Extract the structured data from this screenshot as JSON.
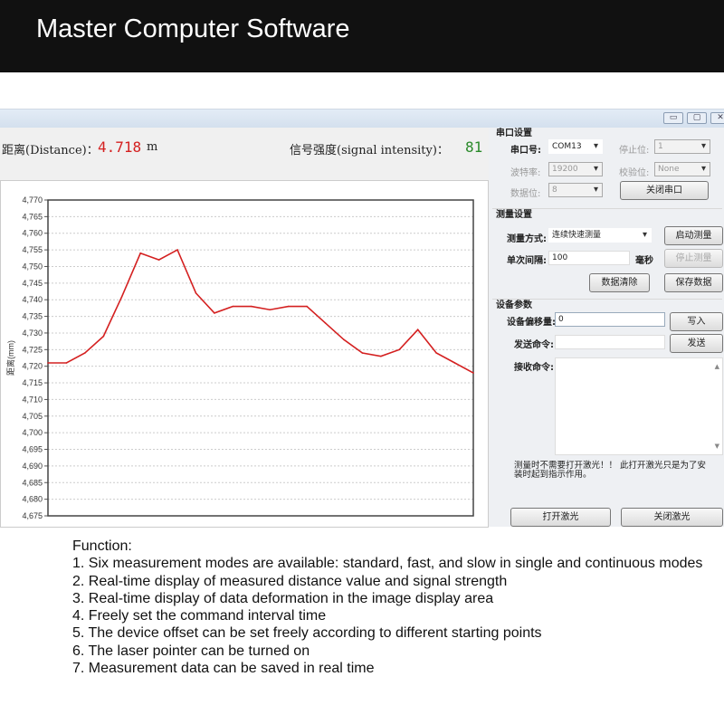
{
  "header": {
    "title": "Master Computer Software"
  },
  "window": {
    "controls": [
      "minimize",
      "maximize",
      "close"
    ]
  },
  "readout": {
    "distance_label": "距离(Distance)：",
    "distance_value": "4.718",
    "distance_unit": "m",
    "signal_label": "信号强度(signal intensity)：",
    "signal_value": "81",
    "distance_color": "#d42020",
    "signal_color": "#2a8a2a"
  },
  "chart_data": {
    "type": "line",
    "ylabel": "距离(mm)",
    "ylim": [
      4675,
      4770
    ],
    "yticks": [
      "4,770",
      "4,765",
      "4,760",
      "4,755",
      "4,750",
      "4,745",
      "4,740",
      "4,735",
      "4,730",
      "4,725",
      "4,720",
      "4,715",
      "4,710",
      "4,705",
      "4,700",
      "4,695",
      "4,690",
      "4,685",
      "4,680",
      "4,675"
    ],
    "grid": true,
    "line_color": "#d42020",
    "values": [
      4721,
      4721,
      4724,
      4729,
      4741,
      4754,
      4752,
      4755,
      4742,
      4736,
      4738,
      4738,
      4737,
      4738,
      4738,
      4733,
      4728,
      4724,
      4723,
      4725,
      4731,
      4724,
      4721,
      4718
    ]
  },
  "panel": {
    "serial": {
      "title": "串口设置",
      "port_label": "串口号:",
      "port": "COM13",
      "stop_label": "停止位:",
      "stop": "1",
      "baud_label": "波特率:",
      "baud": "19200",
      "parity_label": "校验位:",
      "parity": "None",
      "data_label": "数据位:",
      "data": "8",
      "close_port": "关闭串口"
    },
    "measure": {
      "title": "测量设置",
      "mode_label": "测量方式:",
      "mode": "连续快速测量",
      "start": "启动测量",
      "interval_label": "单次间隔:",
      "interval": "100",
      "unit": "毫秒",
      "stop": "停止测量",
      "clear": "数据清除",
      "save": "保存数据"
    },
    "device": {
      "title": "设备参数",
      "offset_label": "设备偏移量:",
      "offset": "0",
      "write": "写入",
      "send_label": "发送命令:",
      "send_value": "",
      "send": "发送",
      "recv_label": "接收命令:",
      "note": "测量时不需要打开激光！！ 此打开激光只是为了安装时起到指示作用。",
      "laser_on": "打开激光",
      "laser_off": "关闭激光"
    }
  },
  "functions": {
    "title": "Function:",
    "items": [
      "1. Six measurement modes are available: standard, fast, and slow in single and continuous modes",
      "2. Real-time display of measured distance value and signal strength",
      "3. Real-time display of data deformation in the image display area",
      "4. Freely set the command interval time",
      "5. The device offset can be set freely according to different starting points",
      "6. The laser pointer can be turned on",
      "7. Measurement data can be saved in real time"
    ]
  }
}
